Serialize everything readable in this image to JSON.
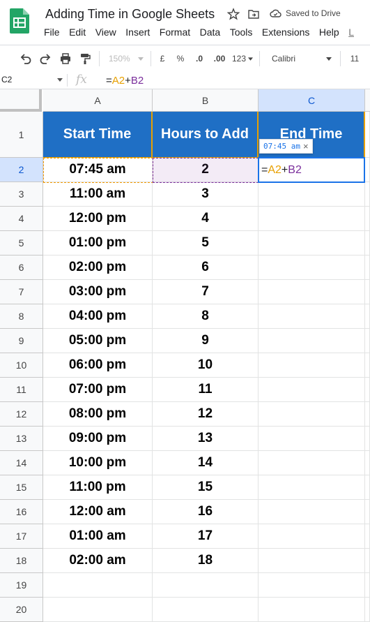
{
  "app": {
    "title": "Adding Time in Google Sheets",
    "saved_status": "Saved to Drive",
    "menu": [
      "File",
      "Edit",
      "View",
      "Insert",
      "Format",
      "Data",
      "Tools",
      "Extensions",
      "Help",
      "L"
    ]
  },
  "toolbar": {
    "zoom": "150%",
    "currency": "£",
    "percent": "%",
    "decrease_decimal": ".0",
    "increase_decimal": ".00",
    "more_formats": "123",
    "font": "Calibri",
    "font_size": "11"
  },
  "formula_bar": {
    "name_box": "C2",
    "fx": "fx",
    "eq": "=",
    "ref_a": "A2",
    "plus": "+",
    "ref_b": "B2"
  },
  "columns": [
    "A",
    "B",
    "C"
  ],
  "header_row": [
    "Start Time",
    "Hours to Add",
    "End Time"
  ],
  "rows": [
    {
      "n": "1"
    },
    {
      "n": "2",
      "a": "07:45 am",
      "b": "2"
    },
    {
      "n": "3",
      "a": "11:00 am",
      "b": "3"
    },
    {
      "n": "4",
      "a": "12:00 pm",
      "b": "4"
    },
    {
      "n": "5",
      "a": "01:00 pm",
      "b": "5"
    },
    {
      "n": "6",
      "a": "02:00 pm",
      "b": "6"
    },
    {
      "n": "7",
      "a": "03:00 pm",
      "b": "7"
    },
    {
      "n": "8",
      "a": "04:00 pm",
      "b": "8"
    },
    {
      "n": "9",
      "a": "05:00 pm",
      "b": "9"
    },
    {
      "n": "10",
      "a": "06:00 pm",
      "b": "10"
    },
    {
      "n": "11",
      "a": "07:00 pm",
      "b": "11"
    },
    {
      "n": "12",
      "a": "08:00 pm",
      "b": "12"
    },
    {
      "n": "13",
      "a": "09:00 pm",
      "b": "13"
    },
    {
      "n": "14",
      "a": "10:00 pm",
      "b": "14"
    },
    {
      "n": "15",
      "a": "11:00 pm",
      "b": "15"
    },
    {
      "n": "16",
      "a": "12:00 am",
      "b": "16"
    },
    {
      "n": "17",
      "a": "01:00 am",
      "b": "17"
    },
    {
      "n": "18",
      "a": "02:00 am",
      "b": "18"
    },
    {
      "n": "19"
    },
    {
      "n": "20"
    }
  ],
  "active_cell": {
    "ref": "C2",
    "eq": "=",
    "ref_a": "A2",
    "plus": "+",
    "ref_b": "B2"
  },
  "tooltip": {
    "value": "07:45 am",
    "close": "×"
  },
  "colors": {
    "header_bg": "#1f6fc5",
    "ref_a": "#e8a000",
    "ref_b": "#7a2d9b",
    "selection": "#1a73e8"
  }
}
